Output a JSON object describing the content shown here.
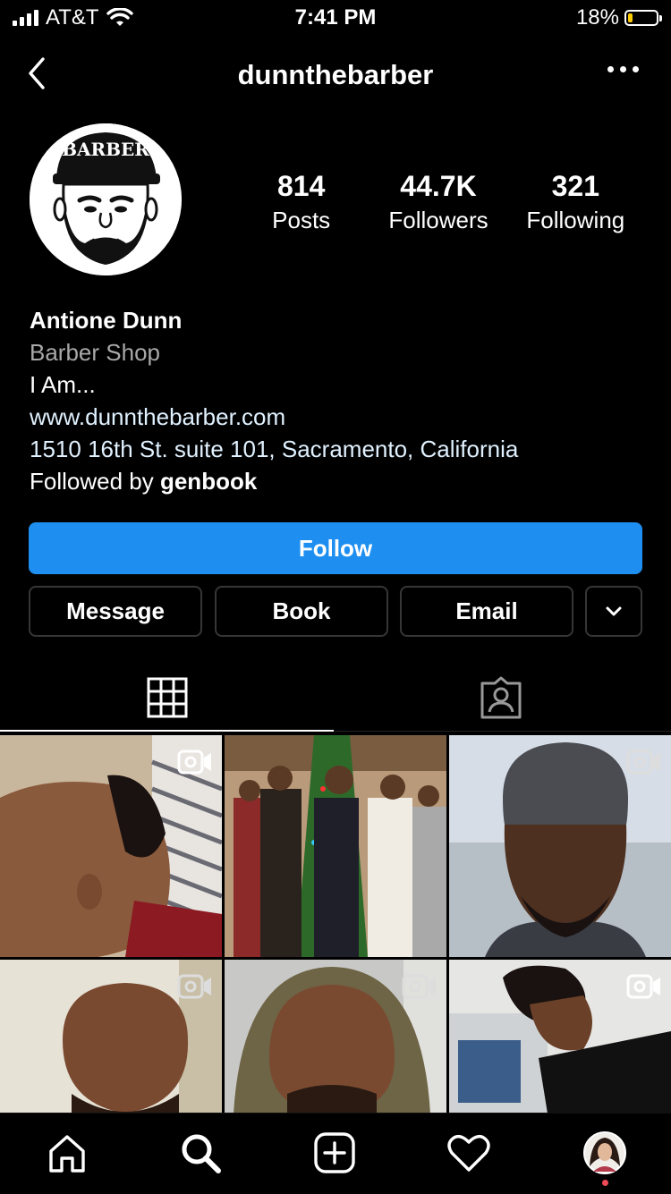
{
  "status_bar": {
    "carrier": "AT&T",
    "time": "7:41 PM",
    "battery": "18%",
    "battery_level": 0.18
  },
  "header": {
    "username": "dunnthebarber"
  },
  "profile": {
    "avatar_cap_text": "BARBER",
    "stats": [
      {
        "value": "814",
        "label": "Posts"
      },
      {
        "value": "44.7K",
        "label": "Followers"
      },
      {
        "value": "321",
        "label": "Following"
      }
    ],
    "name": "Antione Dunn",
    "category": "Barber Shop",
    "bio": "I Am...",
    "website": "www.dunnthebarber.com",
    "address": "1510 16th St. suite 101, Sacramento, California",
    "followed_by_prefix": "Followed by ",
    "followed_by_user": "genbook"
  },
  "buttons": {
    "follow": "Follow",
    "message": "Message",
    "book": "Book",
    "email": "Email"
  },
  "tabs": [
    {
      "name": "grid",
      "icon": "grid-icon",
      "active": true
    },
    {
      "name": "tagged",
      "icon": "tagged-person-icon",
      "active": false
    }
  ],
  "posts": [
    {
      "type": "video",
      "theme": "barber-cut-side-profile"
    },
    {
      "type": "photo",
      "theme": "family-christmas-tree"
    },
    {
      "type": "video",
      "theme": "beanie-selfie"
    },
    {
      "type": "video",
      "theme": "bald-selfie"
    },
    {
      "type": "video",
      "theme": "hooded-selfie"
    },
    {
      "type": "video",
      "theme": "barber-shop-haircut"
    }
  ],
  "colors": {
    "accent": "#1e8ff0",
    "notification": "#ed4956",
    "battery": "#ffcc00"
  },
  "bottom_nav": [
    "home-icon",
    "search-icon",
    "new-post-icon",
    "activity-heart-icon",
    "profile-avatar-icon"
  ]
}
